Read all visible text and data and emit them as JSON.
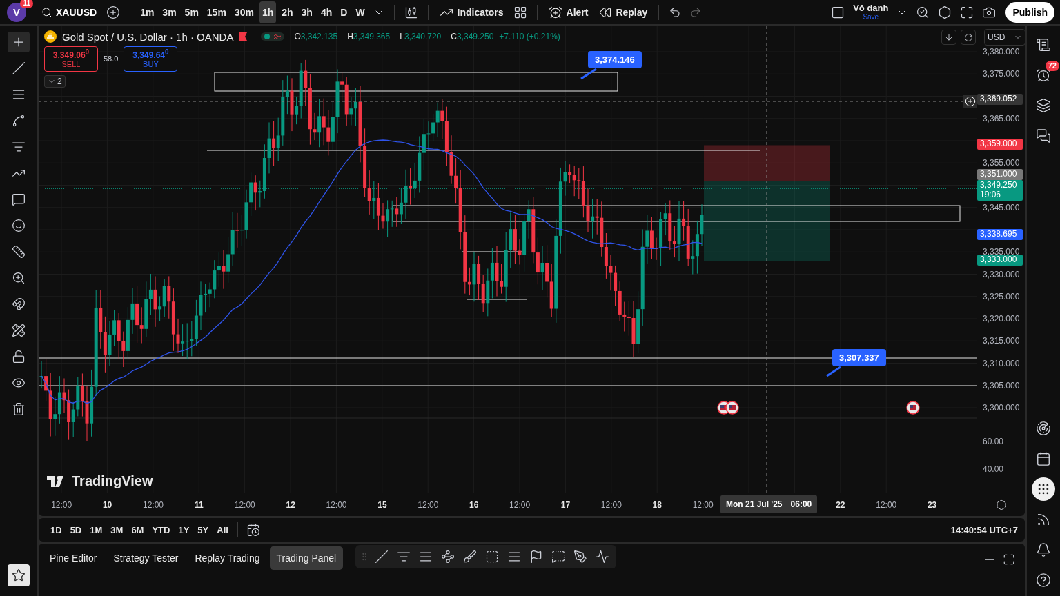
{
  "topbar": {
    "avatar": "V",
    "avatar_badge": "11",
    "symbol": "XAUUSD",
    "intervals": [
      {
        "label": "1m",
        "selected": false
      },
      {
        "label": "3m",
        "selected": false
      },
      {
        "label": "5m",
        "selected": false
      },
      {
        "label": "15m",
        "selected": false
      },
      {
        "label": "30m",
        "selected": false
      },
      {
        "label": "1h",
        "selected": true
      },
      {
        "label": "2h",
        "selected": false
      },
      {
        "label": "3h",
        "selected": false
      },
      {
        "label": "4h",
        "selected": false
      },
      {
        "label": "D",
        "selected": false
      },
      {
        "label": "W",
        "selected": false
      }
    ],
    "indicators": "Indicators",
    "alert": "Alert",
    "replay": "Replay",
    "layout_name": "Vô danh",
    "save": "Save",
    "publish": "Publish"
  },
  "legend": {
    "title": "Gold Spot / U.S. Dollar · 1h · OANDA",
    "ohlc": [
      {
        "label": "O",
        "value": "3,342.135"
      },
      {
        "label": "H",
        "value": "3,349.365"
      },
      {
        "label": "L",
        "value": "3,340.720"
      },
      {
        "label": "C",
        "value": "3,349.250"
      }
    ],
    "change": "+7.110 (+0.21%)",
    "sell_price": "3,349.06$^{0}$",
    "sell": "SELL",
    "spread": "58.0",
    "buy_price": "3,349.64$^{0}$",
    "buy": "BUY",
    "indicators_count": "2"
  },
  "callouts": [
    "3,374.146",
    "3,307.337"
  ],
  "price_axis": {
    "currency": "USD",
    "ticks": [
      "3,380.000",
      "3,375.000",
      "3,365.000",
      "3,355.000",
      "3,345.000",
      "3,335.000",
      "3,330.000",
      "3,325.000",
      "3,320.000",
      "3,315.000",
      "3,310.000",
      "3,305.000",
      "3,300.000"
    ],
    "markers": [
      {
        "kind": "crosshair",
        "text": "3,369.052"
      },
      {
        "kind": "stop",
        "text": "3,359.000"
      },
      {
        "kind": "entry",
        "text": "3,351.000"
      },
      {
        "kind": "last",
        "text": "3,349.250",
        "countdown": "19:06"
      },
      {
        "kind": "average",
        "text": "3,338.695"
      },
      {
        "kind": "target",
        "text": "3,333.000"
      }
    ]
  },
  "indicator_axis": [
    "60.00",
    "40.00"
  ],
  "brand": "TradingView",
  "time_axis": {
    "ticks": [
      {
        "kind": "time",
        "text": "12:00"
      },
      {
        "kind": "day",
        "text": "10"
      },
      {
        "kind": "time",
        "text": "12:00"
      },
      {
        "kind": "day",
        "text": "11"
      },
      {
        "kind": "time",
        "text": "12:00"
      },
      {
        "kind": "day",
        "text": "12"
      },
      {
        "kind": "time",
        "text": "12:00"
      },
      {
        "kind": "day",
        "text": "15"
      },
      {
        "kind": "time",
        "text": "12:00"
      },
      {
        "kind": "day",
        "text": "16"
      },
      {
        "kind": "time",
        "text": "12:00"
      },
      {
        "kind": "day",
        "text": "17"
      },
      {
        "kind": "time",
        "text": "12:00"
      },
      {
        "kind": "day",
        "text": "18"
      },
      {
        "kind": "time",
        "text": "12:00"
      },
      {
        "kind": "day",
        "text": "22"
      },
      {
        "kind": "time",
        "text": "12:00"
      },
      {
        "kind": "day",
        "text": "23"
      }
    ],
    "crosshair_date": "Mon 21 Jul '25",
    "crosshair_time": "06:00"
  },
  "ranges": [
    "1D",
    "5D",
    "1M",
    "3M",
    "6M",
    "YTD",
    "1Y",
    "5Y",
    "All"
  ],
  "clock": "14:40:54 UTC+7",
  "bottom_tabs": [
    {
      "label": "Pine Editor",
      "selected": false
    },
    {
      "label": "Strategy Tester",
      "selected": false
    },
    {
      "label": "Replay Trading",
      "selected": false
    },
    {
      "label": "Trading Panel",
      "selected": true
    }
  ],
  "alerts_badge": "72"
}
